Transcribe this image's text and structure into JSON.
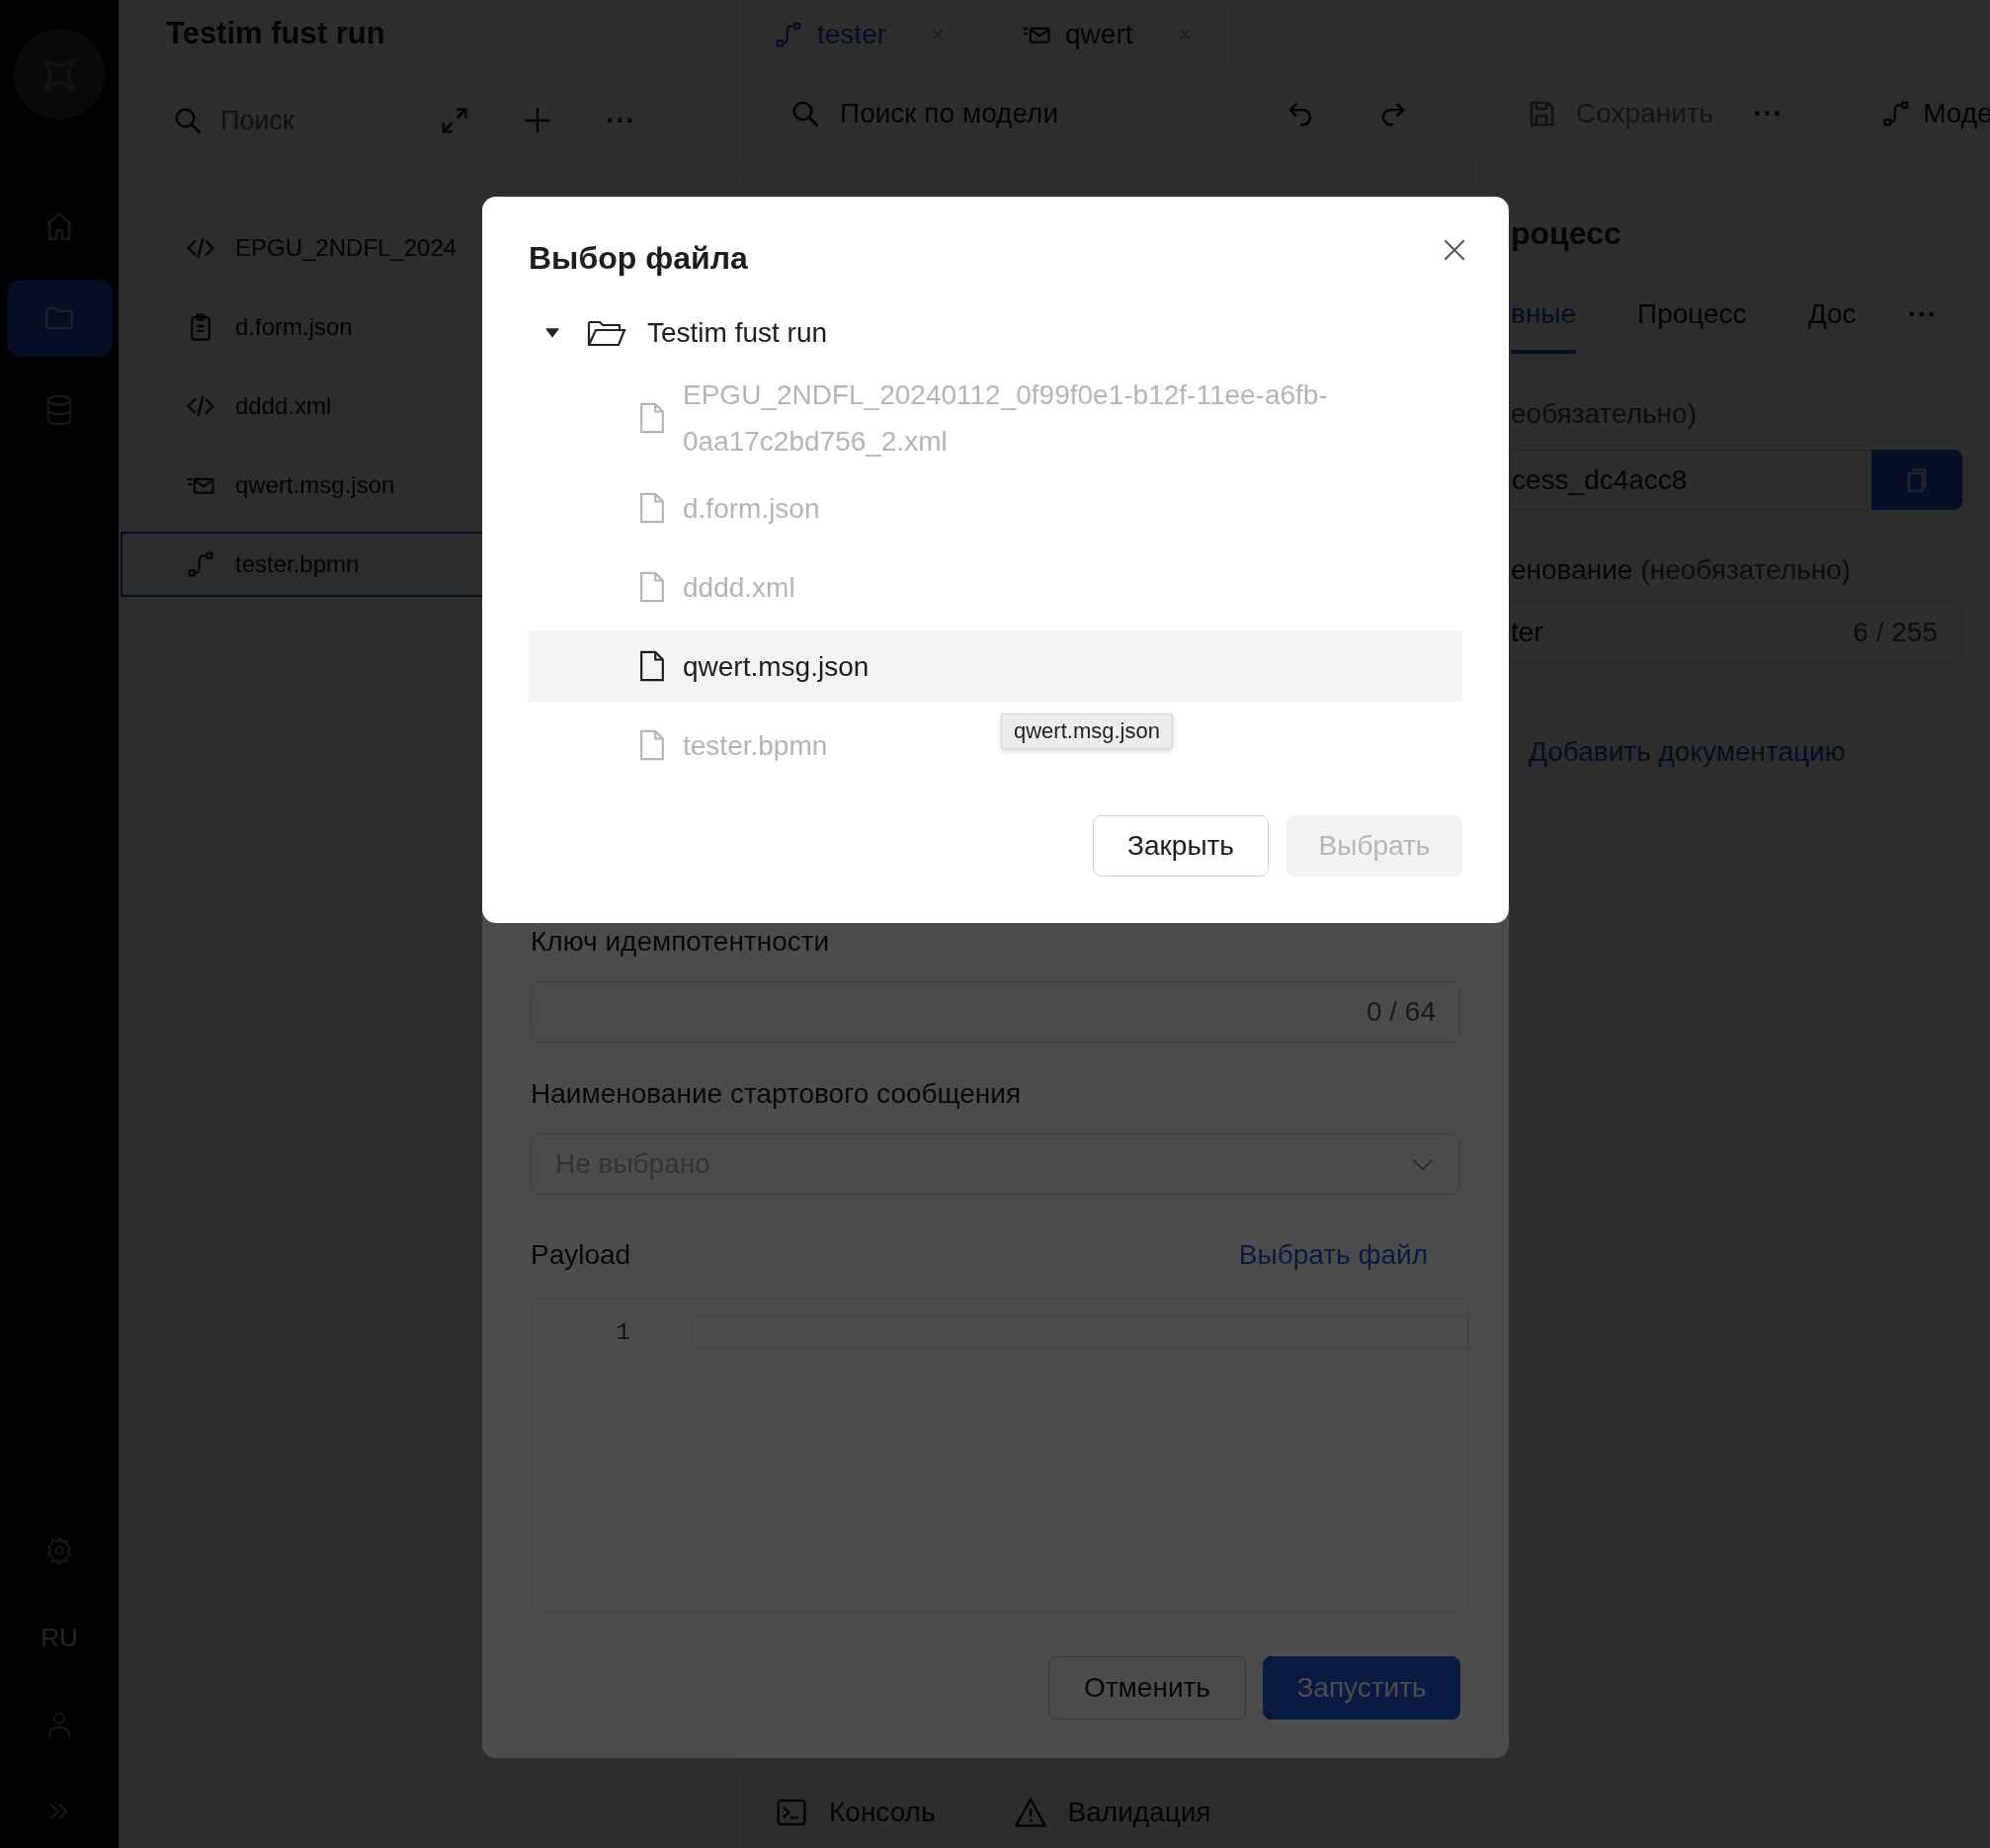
{
  "rail": {
    "items": [
      {
        "kind": "home",
        "selected": false
      },
      {
        "kind": "folder",
        "selected": true
      },
      {
        "kind": "database",
        "selected": false
      }
    ],
    "language": "RU"
  },
  "explorer": {
    "title": "Testim fust run",
    "search": {
      "placeholder": "Поиск"
    },
    "more": "···",
    "files": [
      {
        "name": "EPGU_2NDFL_2024",
        "kind": "code",
        "selected": false
      },
      {
        "name": "d.form.json",
        "kind": "form",
        "selected": false
      },
      {
        "name": "dddd.xml",
        "kind": "code",
        "selected": false
      },
      {
        "name": "qwert.msg.json",
        "kind": "message",
        "selected": false
      },
      {
        "name": "tester.bpmn",
        "kind": "process",
        "selected": true
      }
    ]
  },
  "tabs": [
    {
      "label": "tester",
      "kind": "process",
      "selected": true
    },
    {
      "label": "qwert",
      "kind": "message",
      "selected": false
    }
  ],
  "toolbar": {
    "search": "Поиск по модели",
    "save": {
      "label": "Сохранить",
      "disabled": true
    },
    "more": "···",
    "mode": "Моде"
  },
  "properties": {
    "title": "роцесс",
    "tabs": [
      {
        "label": "вные",
        "selected": true
      },
      {
        "label": "Процесс",
        "selected": false
      },
      {
        "label": "Дос",
        "selected": false
      }
    ],
    "more": "···",
    "fields": [
      {
        "kind": "copy",
        "hint": "еобязательно)",
        "value": "cess_dc4acc8"
      },
      {
        "kind": "counter",
        "label": "енование",
        "hint": "(необязательно)",
        "value": "ter",
        "counter": "6 / 255"
      }
    ],
    "link": "Добавить документацию"
  },
  "bottom_bar": {
    "items": [
      {
        "kind": "console",
        "label": "Консоль"
      },
      {
        "kind": "validation",
        "label": "Валидация"
      }
    ]
  },
  "run_dialog": {
    "fields": [
      {
        "kind": "text",
        "label": "Ключ идемпотентности",
        "counter": "0 / 64"
      },
      {
        "kind": "select",
        "label": "Наименование стартового сообщения",
        "placeholder": "Не выбрано"
      }
    ],
    "payload": {
      "label": "Payload",
      "link": "Выбрать файл",
      "line_numbers": [
        "1"
      ]
    },
    "buttons": [
      {
        "label": "Отменить",
        "kind": "secondary"
      },
      {
        "label": "Запустить",
        "kind": "primary"
      }
    ]
  },
  "file_dialog": {
    "title": "Выбор файла",
    "tree": {
      "label": "Testim fust run",
      "expanded": true,
      "children": [
        {
          "label": "EPGU_2NDFL_20240112_0f99f0e1-b12f-11ee-a6fb-0aa17c2bd756_2.xml",
          "disabled": true,
          "selected": false
        },
        {
          "label": "d.form.json",
          "disabled": true,
          "selected": false
        },
        {
          "label": "dddd.xml",
          "disabled": true,
          "selected": false
        },
        {
          "label": "qwert.msg.json",
          "disabled": false,
          "selected": true
        },
        {
          "label": "tester.bpmn",
          "disabled": true,
          "selected": false
        }
      ]
    },
    "tooltip": "qwert.msg.json",
    "buttons": [
      {
        "label": "Закрыть",
        "kind": "secondary",
        "disabled": false
      },
      {
        "label": "Выбрать",
        "kind": "primary",
        "disabled": true
      }
    ]
  }
}
